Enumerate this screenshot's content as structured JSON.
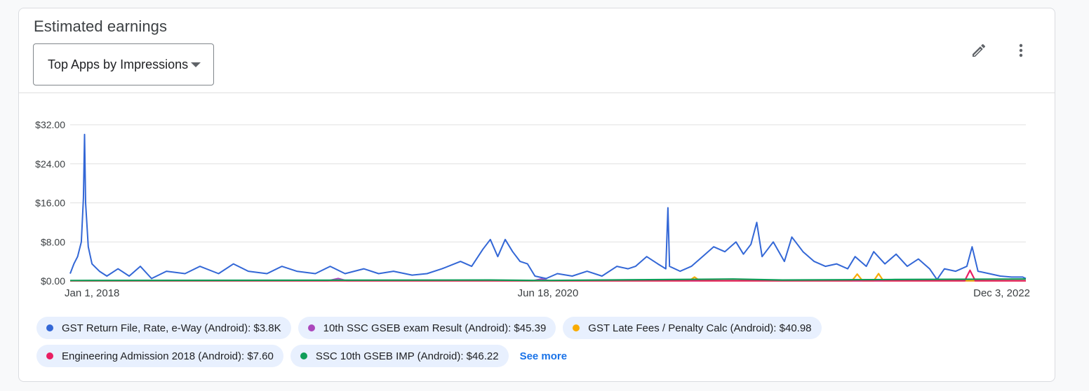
{
  "card": {
    "title": "Estimated earnings",
    "selector": {
      "value": "Top Apps by Impressions"
    },
    "see_more": "See more"
  },
  "icons": {
    "edit": "pencil-icon",
    "more": "more-vert-icon",
    "dropdown": "dropdown-arrow-icon"
  },
  "chart_data": {
    "type": "line",
    "ylim": [
      0,
      32
    ],
    "y_ticks": [
      "$0.00",
      "$8.00",
      "$16.00",
      "$24.00",
      "$32.00"
    ],
    "x_ticks": [
      "Jan 1, 2018",
      "Jun 18, 2020",
      "Dec 3, 2022"
    ],
    "x_range": [
      "2018-01-01",
      "2022-12-03"
    ],
    "grid": true,
    "legend_position": "bottom",
    "series": [
      {
        "name": "GST Return File, Rate, e-Way (Android)",
        "total": "$3.8K",
        "color": "#3367d6",
        "points": [
          [
            "2018-01-01",
            1.5
          ],
          [
            "2018-01-08",
            3.5
          ],
          [
            "2018-01-15",
            5.0
          ],
          [
            "2018-01-22",
            8.0
          ],
          [
            "2018-01-26",
            17.0
          ],
          [
            "2018-01-28",
            30.0
          ],
          [
            "2018-01-30",
            16.0
          ],
          [
            "2018-02-04",
            7.0
          ],
          [
            "2018-02-11",
            3.5
          ],
          [
            "2018-02-25",
            2.0
          ],
          [
            "2018-03-11",
            1.0
          ],
          [
            "2018-04-01",
            2.5
          ],
          [
            "2018-04-22",
            1.0
          ],
          [
            "2018-05-13",
            3.0
          ],
          [
            "2018-06-03",
            0.5
          ],
          [
            "2018-07-01",
            2.0
          ],
          [
            "2018-08-05",
            1.5
          ],
          [
            "2018-09-02",
            3.0
          ],
          [
            "2018-10-07",
            1.5
          ],
          [
            "2018-11-04",
            3.5
          ],
          [
            "2018-12-02",
            2.0
          ],
          [
            "2019-01-06",
            1.5
          ],
          [
            "2019-02-03",
            3.0
          ],
          [
            "2019-03-03",
            2.0
          ],
          [
            "2019-04-07",
            1.5
          ],
          [
            "2019-05-05",
            3.0
          ],
          [
            "2019-06-02",
            1.5
          ],
          [
            "2019-07-07",
            2.5
          ],
          [
            "2019-08-04",
            1.5
          ],
          [
            "2019-09-01",
            2.0
          ],
          [
            "2019-10-06",
            1.2
          ],
          [
            "2019-11-03",
            1.5
          ],
          [
            "2019-12-01",
            2.5
          ],
          [
            "2020-01-05",
            4.0
          ],
          [
            "2020-01-26",
            3.0
          ],
          [
            "2020-02-16",
            6.5
          ],
          [
            "2020-03-01",
            8.5
          ],
          [
            "2020-03-15",
            5.0
          ],
          [
            "2020-03-29",
            8.5
          ],
          [
            "2020-04-12",
            6.0
          ],
          [
            "2020-04-26",
            4.0
          ],
          [
            "2020-05-10",
            3.5
          ],
          [
            "2020-05-24",
            1.0
          ],
          [
            "2020-06-14",
            0.5
          ],
          [
            "2020-07-05",
            1.5
          ],
          [
            "2020-08-02",
            1.0
          ],
          [
            "2020-08-30",
            2.0
          ],
          [
            "2020-09-27",
            1.0
          ],
          [
            "2020-10-25",
            3.0
          ],
          [
            "2020-11-15",
            2.5
          ],
          [
            "2020-11-29",
            3.0
          ],
          [
            "2020-12-20",
            5.0
          ],
          [
            "2021-01-10",
            3.5
          ],
          [
            "2021-01-25",
            2.5
          ],
          [
            "2021-01-29",
            15.0
          ],
          [
            "2021-02-01",
            3.0
          ],
          [
            "2021-02-21",
            2.0
          ],
          [
            "2021-03-14",
            3.0
          ],
          [
            "2021-04-04",
            5.0
          ],
          [
            "2021-04-25",
            7.0
          ],
          [
            "2021-05-16",
            6.0
          ],
          [
            "2021-06-06",
            8.0
          ],
          [
            "2021-06-20",
            5.5
          ],
          [
            "2021-07-04",
            7.5
          ],
          [
            "2021-07-15",
            12.0
          ],
          [
            "2021-07-25",
            5.0
          ],
          [
            "2021-08-15",
            8.0
          ],
          [
            "2021-09-05",
            4.0
          ],
          [
            "2021-09-19",
            9.0
          ],
          [
            "2021-10-10",
            6.0
          ],
          [
            "2021-10-31",
            4.0
          ],
          [
            "2021-11-21",
            3.0
          ],
          [
            "2021-12-12",
            3.5
          ],
          [
            "2022-01-02",
            2.5
          ],
          [
            "2022-01-16",
            5.0
          ],
          [
            "2022-02-06",
            3.0
          ],
          [
            "2022-02-20",
            6.0
          ],
          [
            "2022-03-13",
            3.5
          ],
          [
            "2022-04-03",
            5.5
          ],
          [
            "2022-04-24",
            3.0
          ],
          [
            "2022-05-15",
            4.5
          ],
          [
            "2022-06-05",
            2.5
          ],
          [
            "2022-06-19",
            0.3
          ],
          [
            "2022-07-03",
            2.5
          ],
          [
            "2022-07-24",
            2.0
          ],
          [
            "2022-08-14",
            3.0
          ],
          [
            "2022-08-24",
            7.0
          ],
          [
            "2022-09-04",
            2.0
          ],
          [
            "2022-09-25",
            1.5
          ],
          [
            "2022-10-16",
            1.0
          ],
          [
            "2022-11-06",
            0.8
          ],
          [
            "2022-11-27",
            0.8
          ],
          [
            "2022-12-03",
            0.5
          ]
        ]
      },
      {
        "name": "10th SSC GSEB exam Result (Android)",
        "total": "$45.39",
        "color": "#ab47bc",
        "points": [
          [
            "2018-01-01",
            0.05
          ],
          [
            "2019-05-01",
            0.05
          ],
          [
            "2019-05-20",
            0.5
          ],
          [
            "2019-06-05",
            0.05
          ],
          [
            "2020-05-20",
            0.05
          ],
          [
            "2020-06-05",
            0.4
          ],
          [
            "2020-06-20",
            0.05
          ],
          [
            "2022-12-03",
            0.05
          ]
        ]
      },
      {
        "name": "GST Late Fees / Penalty Calc (Android)",
        "total": "$40.98",
        "color": "#f9ab00",
        "points": [
          [
            "2018-01-01",
            0.05
          ],
          [
            "2021-03-10",
            0.05
          ],
          [
            "2021-03-20",
            0.8
          ],
          [
            "2021-03-30",
            0.05
          ],
          [
            "2022-01-10",
            0.05
          ],
          [
            "2022-01-20",
            1.4
          ],
          [
            "2022-01-30",
            0.05
          ],
          [
            "2022-02-20",
            0.05
          ],
          [
            "2022-03-01",
            1.5
          ],
          [
            "2022-03-10",
            0.05
          ],
          [
            "2022-12-03",
            0.05
          ]
        ]
      },
      {
        "name": "Engineering Admission 2018 (Android)",
        "total": "$7.60",
        "color": "#e91e63",
        "points": [
          [
            "2018-01-01",
            0.05
          ],
          [
            "2022-08-10",
            0.05
          ],
          [
            "2022-08-20",
            2.2
          ],
          [
            "2022-08-30",
            0.05
          ],
          [
            "2022-12-03",
            0.05
          ]
        ]
      },
      {
        "name": "SSC 10th GSEB IMP (Android)",
        "total": "$46.22",
        "color": "#0f9d58",
        "points": [
          [
            "2018-01-01",
            0.1
          ],
          [
            "2020-03-01",
            0.2
          ],
          [
            "2020-06-01",
            0.1
          ],
          [
            "2021-06-01",
            0.4
          ],
          [
            "2021-09-01",
            0.2
          ],
          [
            "2022-04-01",
            0.3
          ],
          [
            "2022-12-03",
            0.4
          ]
        ]
      }
    ]
  }
}
